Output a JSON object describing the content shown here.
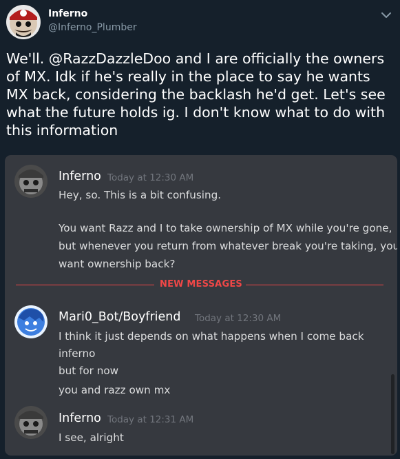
{
  "tweet": {
    "display_name": "Inferno",
    "handle": "@Inferno_Plumber",
    "text_before_mention": "We'll. ",
    "mention": "@RazzDazzleDoo",
    "text_after_mention": " and I are officially the owners of MX. Idk if he's really in the place to say he wants MX back, considering the backlash he'd get. Let's see what the future holds ig. I don't know what to do with this information",
    "chevron_icon": "chevron-down-icon"
  },
  "discord": {
    "divider_label": "NEW MESSAGES",
    "messages": [
      {
        "author": "Inferno",
        "timestamp": "Today at 12:30 AM",
        "lines": [
          "Hey, so. This is a bit confusing.",
          "You want Razz and I to take ownership of MX while you're gone,",
          "but whenever you return from whatever break you're taking, you",
          "want ownership back?"
        ]
      },
      {
        "author": "Mari0_Bot/Boyfriend",
        "timestamp": "Today at 12:30 AM",
        "lines": [
          "I think it just depends on what happens when I come back",
          "inferno",
          "but for now",
          "you and razz own mx"
        ]
      },
      {
        "author": "Inferno",
        "timestamp": "Today at 12:31 AM",
        "lines": [
          "I see, alright"
        ]
      }
    ]
  },
  "colors": {
    "background": "#15202b",
    "embed_background": "#36393f",
    "new_messages_red": "#f04747",
    "timestamp_gray": "#72767d",
    "handle_gray": "#8899a6"
  }
}
